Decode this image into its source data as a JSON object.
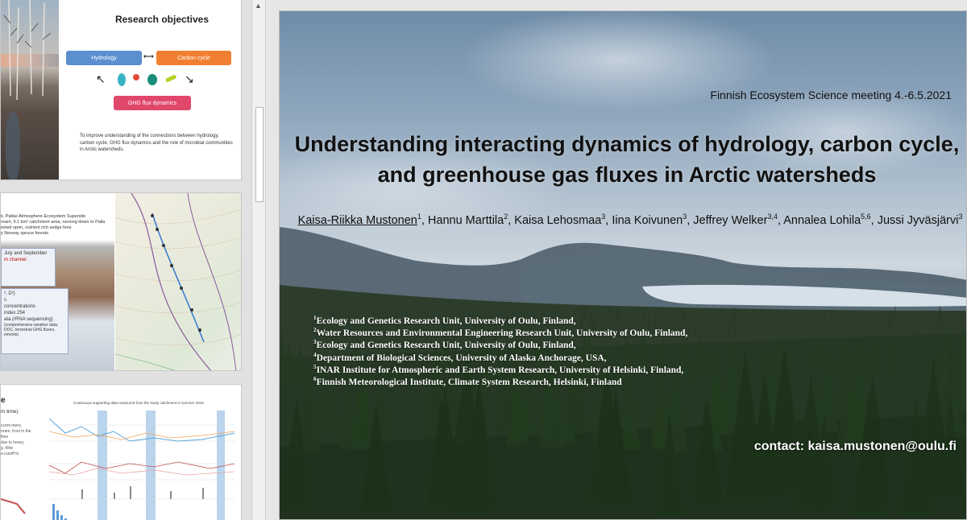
{
  "thumbnails": {
    "slide1": {
      "title": "Research objectives",
      "boxes": {
        "hydrology": "Hydrology",
        "carbon": "Carbon cycle",
        "ghg": "GHG flux dynamics"
      },
      "body": "To improve understanding of the connections between hydrology, carbon cycle, GHG flux dynamics and the role of microbial communities in Arctic watersheds."
    },
    "slide2": {
      "text_lines": [
        "k, Pallas Atmosphere-Ecosystem Supersite",
        "ream, 5.1 km² catchment area, running down to Palla",
        "ested open, nutrient rich sedge fens",
        "y Norway spruce forests"
      ],
      "box1_lines": [
        "July and September",
        "m channel"
      ],
      "box2_lines": [
        "², D²)",
        "s",
        "concentrations",
        "index 254",
        "ata (rRNA sequencing)",
        "(comprehensive weather data,",
        "DOC, terrestrial GHG fluxes,",
        "ements)"
      ]
    },
    "slide3": {
      "heading": "e",
      "subheading": "m time)",
      "lines": [
        "ccent mere,",
        "ream, frost in the",
        "",
        "",
        "flow",
        "",
        "",
        "due to heavy",
        "g. Mire",
        "a runoff to"
      ],
      "chart_title": "Continuous supporting data measured from the study catchment in summer 2019"
    }
  },
  "slide": {
    "conference": "Finnish Ecosystem Science meeting 4.-6.5.2021",
    "title_line1": "Understanding interacting dynamics of hydrology, carbon cycle,",
    "title_line2": "and greenhouse gas fluxes in Arctic watersheds",
    "authors": [
      {
        "name": "Kaisa-Riikka Mustonen",
        "sup": "1"
      },
      {
        "name": "Hannu Marttila",
        "sup": "2"
      },
      {
        "name": "Kaisa Lehosmaa",
        "sup": "3"
      },
      {
        "name": "Iina Koivunen",
        "sup": "3"
      },
      {
        "name": "Jeffrey Welker",
        "sup": "3,4"
      },
      {
        "name": "Annalea Lohila",
        "sup": "5,6"
      },
      {
        "name": "Jussi Jyväsjärvi",
        "sup": "3"
      }
    ],
    "affiliations": [
      {
        "sup": "1",
        "text": "Ecology and Genetics Research Unit, University of Oulu, Finland,"
      },
      {
        "sup": "2",
        "text": "Water Resources and Environmental Engineering Research Unit, University of Oulu, Finland,"
      },
      {
        "sup": "3",
        "text": "Ecology and Genetics Research Unit, University of Oulu, Finland,"
      },
      {
        "sup": "4",
        "text": "Department of Biological Sciences, University of Alaska Anchorage, USA,"
      },
      {
        "sup": "5",
        "text": "INAR Institute for Atmospheric and Earth System Research, University of Helsinki, Finland,"
      },
      {
        "sup": "6",
        "text": "Finnish Meteorological Institute, Climate System Research, Helsinki, Finland"
      }
    ],
    "contact": "contact: kaisa.mustonen@oulu.fi"
  },
  "colors": {
    "hydrology": "#5b8fd0",
    "carbon": "#f07f31",
    "ghg": "#e0476a",
    "accent_blue": "#9ec6e6"
  },
  "icons": [
    "scroll-up-arrow-icon",
    "double-arrow-icon",
    "microbe-icon",
    "arrow-icon"
  ]
}
